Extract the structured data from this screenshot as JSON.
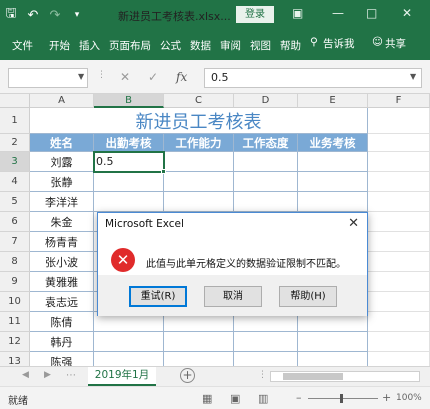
{
  "app": {
    "doc_title": "新进员工考核表.xlsx...",
    "login_label": "登录",
    "colors": {
      "brand": "#217346",
      "header_fill": "#7aa9d6",
      "title_text": "#4a87c4",
      "error": "#e02b2b"
    }
  },
  "menu": {
    "items": [
      "文件",
      "开始",
      "插入",
      "页面布局",
      "公式",
      "数据",
      "审阅",
      "视图",
      "帮助"
    ],
    "tell_me": "告诉我",
    "share": "共享"
  },
  "formula_bar": {
    "name_box": "",
    "fx_label": "fx",
    "value": "0.5"
  },
  "sheet": {
    "columns": [
      "A",
      "B",
      "C",
      "D",
      "E",
      "F"
    ],
    "rows": [
      "1",
      "2",
      "3",
      "4",
      "5",
      "6",
      "7",
      "8",
      "9",
      "10",
      "11",
      "12",
      "13"
    ],
    "title": "新进员工考核表",
    "headers": [
      "姓名",
      "出勤考核",
      "工作能力",
      "工作态度",
      "业务考核"
    ],
    "names": [
      "刘露",
      "张静",
      "李洋洋",
      "朱金",
      "杨青青",
      "张小波",
      "黄雅雅",
      "袁志远",
      "陈倩",
      "韩丹",
      "陈强"
    ],
    "active_value": "0.5"
  },
  "dialog": {
    "title": "Microsoft Excel",
    "message": "此值与此单元格定义的数据验证限制不匹配。",
    "buttons": {
      "retry": "重试(R)",
      "cancel": "取消",
      "help": "帮助(H)"
    }
  },
  "sheet_tabs": {
    "active": "2019年1月"
  },
  "status": {
    "mode": "就绪",
    "zoom": "100%"
  }
}
